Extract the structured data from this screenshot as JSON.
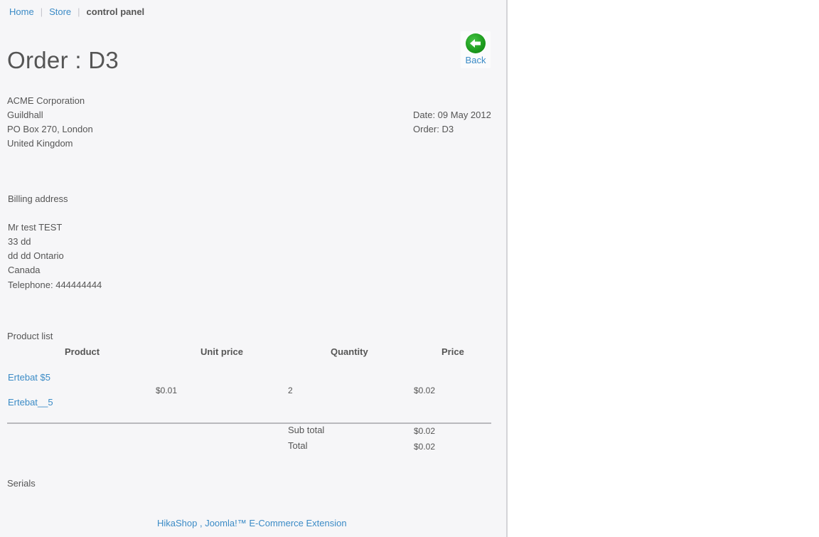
{
  "breadcrumb": {
    "home": "Home",
    "store": "Store",
    "current": "control panel"
  },
  "page": {
    "title": "Order : D3"
  },
  "back_button": {
    "label": "Back",
    "icon": "back-arrow-icon",
    "color": "#1c9a1c"
  },
  "company": {
    "lines": [
      "ACME Corporation",
      "Guildhall",
      "PO Box 270, London",
      "United Kingdom"
    ]
  },
  "order_info": {
    "date": "Date: 09 May 2012",
    "order": "Order: D3"
  },
  "billing": {
    "heading": "Billing address",
    "lines": [
      "Mr test TEST",
      "33 dd",
      "dd dd Ontario",
      "Canada",
      "Telephone: 444444444"
    ]
  },
  "products": {
    "heading": "Product list",
    "columns": [
      "Product",
      "Unit price",
      "Quantity",
      "Price"
    ],
    "rows": [
      {
        "names": [
          "Ertebat $5",
          "Ertebat__5"
        ],
        "unit_price": "$0.01",
        "quantity": "2",
        "price": "$0.02"
      }
    ],
    "subtotal_label": "Sub total",
    "subtotal_value": "$0.02",
    "total_label": "Total",
    "total_value": "$0.02"
  },
  "serials": {
    "heading": "Serials"
  },
  "footer": {
    "link": "HikaShop , Joomla!™ E-Commerce Extension"
  },
  "colors": {
    "link": "#3b8bc6",
    "panel_bg": "#f6f6f8",
    "text": "#555555"
  }
}
